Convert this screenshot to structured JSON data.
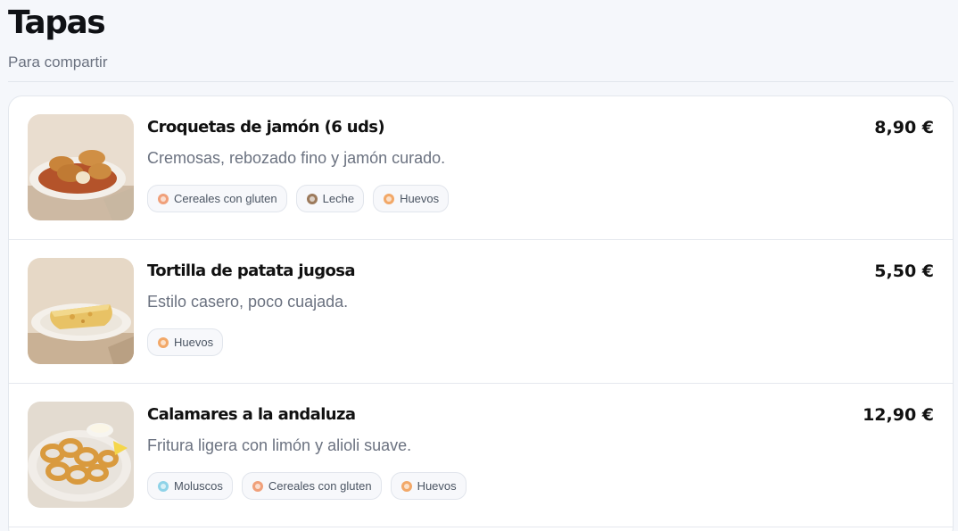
{
  "section": {
    "title": "Tapas",
    "subtitle": "Para compartir"
  },
  "items": [
    {
      "name": "Croquetas de jamón (6 uds)",
      "price": "8,90 €",
      "description": "Cremosas, rebozado fino y jamón curado.",
      "photo_icon": "croquetas-photo",
      "allergens": [
        {
          "label": "Cereales con gluten",
          "icon": "gluten-icon",
          "color": "#f0a07a"
        },
        {
          "label": "Leche",
          "icon": "milk-icon",
          "color": "#9c7a5c"
        },
        {
          "label": "Huevos",
          "icon": "egg-icon",
          "color": "#f2a868"
        }
      ]
    },
    {
      "name": "Tortilla de patata jugosa",
      "price": "5,50 €",
      "description": "Estilo casero, poco cuajada.",
      "photo_icon": "tortilla-photo",
      "allergens": [
        {
          "label": "Huevos",
          "icon": "egg-icon",
          "color": "#f2a868"
        }
      ]
    },
    {
      "name": "Calamares a la andaluza",
      "price": "12,90 €",
      "description": "Fritura ligera con limón y alioli suave.",
      "photo_icon": "calamares-photo",
      "allergens": [
        {
          "label": "Moluscos",
          "icon": "mollusc-icon",
          "color": "#8fd3e8"
        },
        {
          "label": "Cereales con gluten",
          "icon": "gluten-icon",
          "color": "#f0a07a"
        },
        {
          "label": "Huevos",
          "icon": "egg-icon",
          "color": "#f2a868"
        }
      ]
    }
  ]
}
